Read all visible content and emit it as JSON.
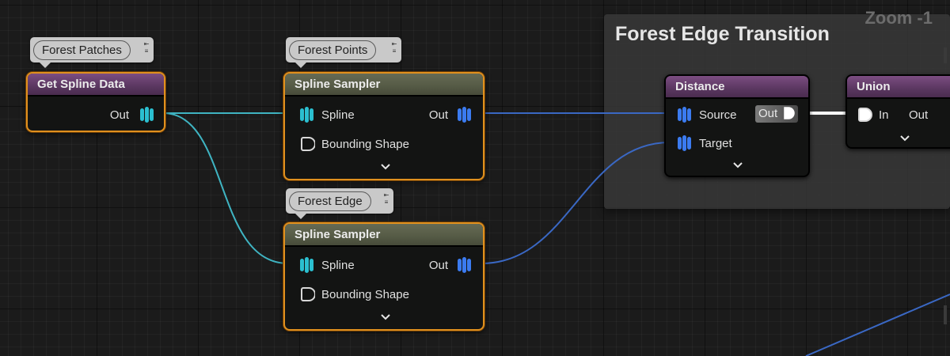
{
  "canvas": {
    "zoom_label": "Zoom -1"
  },
  "comment": {
    "title": "Forest Edge Transition"
  },
  "tags": {
    "forest_patches": "Forest Patches",
    "forest_points": "Forest Points",
    "forest_edge": "Forest Edge"
  },
  "nodes": {
    "get_spline_data": {
      "title": "Get Spline Data",
      "out_label": "Out"
    },
    "sampler_top": {
      "title": "Spline Sampler",
      "in_spline": "Spline",
      "in_bounding": "Bounding Shape",
      "out_label": "Out"
    },
    "sampler_bottom": {
      "title": "Spline Sampler",
      "in_spline": "Spline",
      "in_bounding": "Bounding Shape",
      "out_label": "Out"
    },
    "distance": {
      "title": "Distance",
      "in_source": "Source",
      "in_target": "Target",
      "out_label": "Out"
    },
    "union": {
      "title": "Union",
      "in_label": "In",
      "out_label": "Out"
    }
  },
  "colors": {
    "wire_cyan": "#3fb4c2",
    "wire_blue": "#3a68c4",
    "wire_white": "#ffffff",
    "pin_cyan": "#2bbfd0",
    "pin_blue": "#3b7bf0",
    "selection": "#e0901e",
    "header_purple": "#5a3760",
    "header_olive": "#555a45"
  },
  "icons": {
    "spline_pin": "stacked-spline-icon",
    "point_pin": "stacked-point-icon",
    "concept_pin": "concept-pin-icon",
    "expand": "chevron-down-icon",
    "tag_controls": "pin-collapse-icon"
  }
}
